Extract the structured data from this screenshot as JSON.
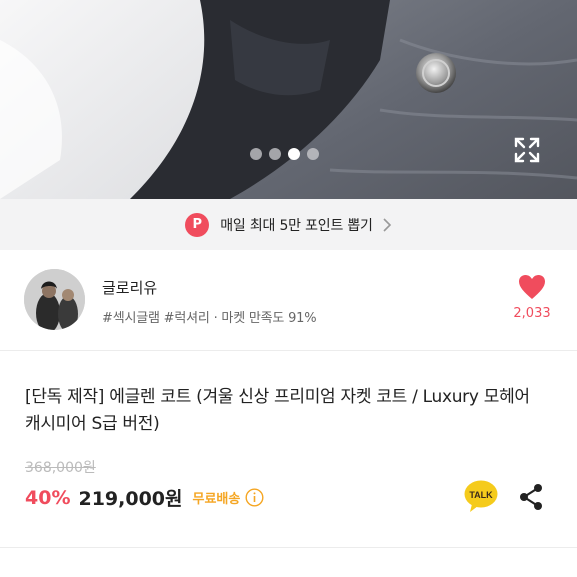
{
  "carousel": {
    "slide_count": 4,
    "active_index": 2,
    "expand_icon": "expand-icon"
  },
  "promo": {
    "badge": "P",
    "text": "매일 최대 5만 포인트 뽑기",
    "accent_color": "#f04c5d"
  },
  "seller": {
    "name": "글로리유",
    "tags": "#섹시글램 #럭셔리 · 마켓 만족도 91%",
    "like_count": "2,033",
    "like_color": "#f04c5d"
  },
  "product": {
    "title": "[단독 제작] 에글렌 코트 (겨울 신상 프리미엄 자켓 코트 / Luxury 모헤어 캐시미어 S급 버전)",
    "original_price": "368,000원",
    "discount": "40%",
    "price": "219,000원",
    "shipping": "무료배송",
    "talk_label": "TALK",
    "shipping_color": "#f5a623"
  }
}
